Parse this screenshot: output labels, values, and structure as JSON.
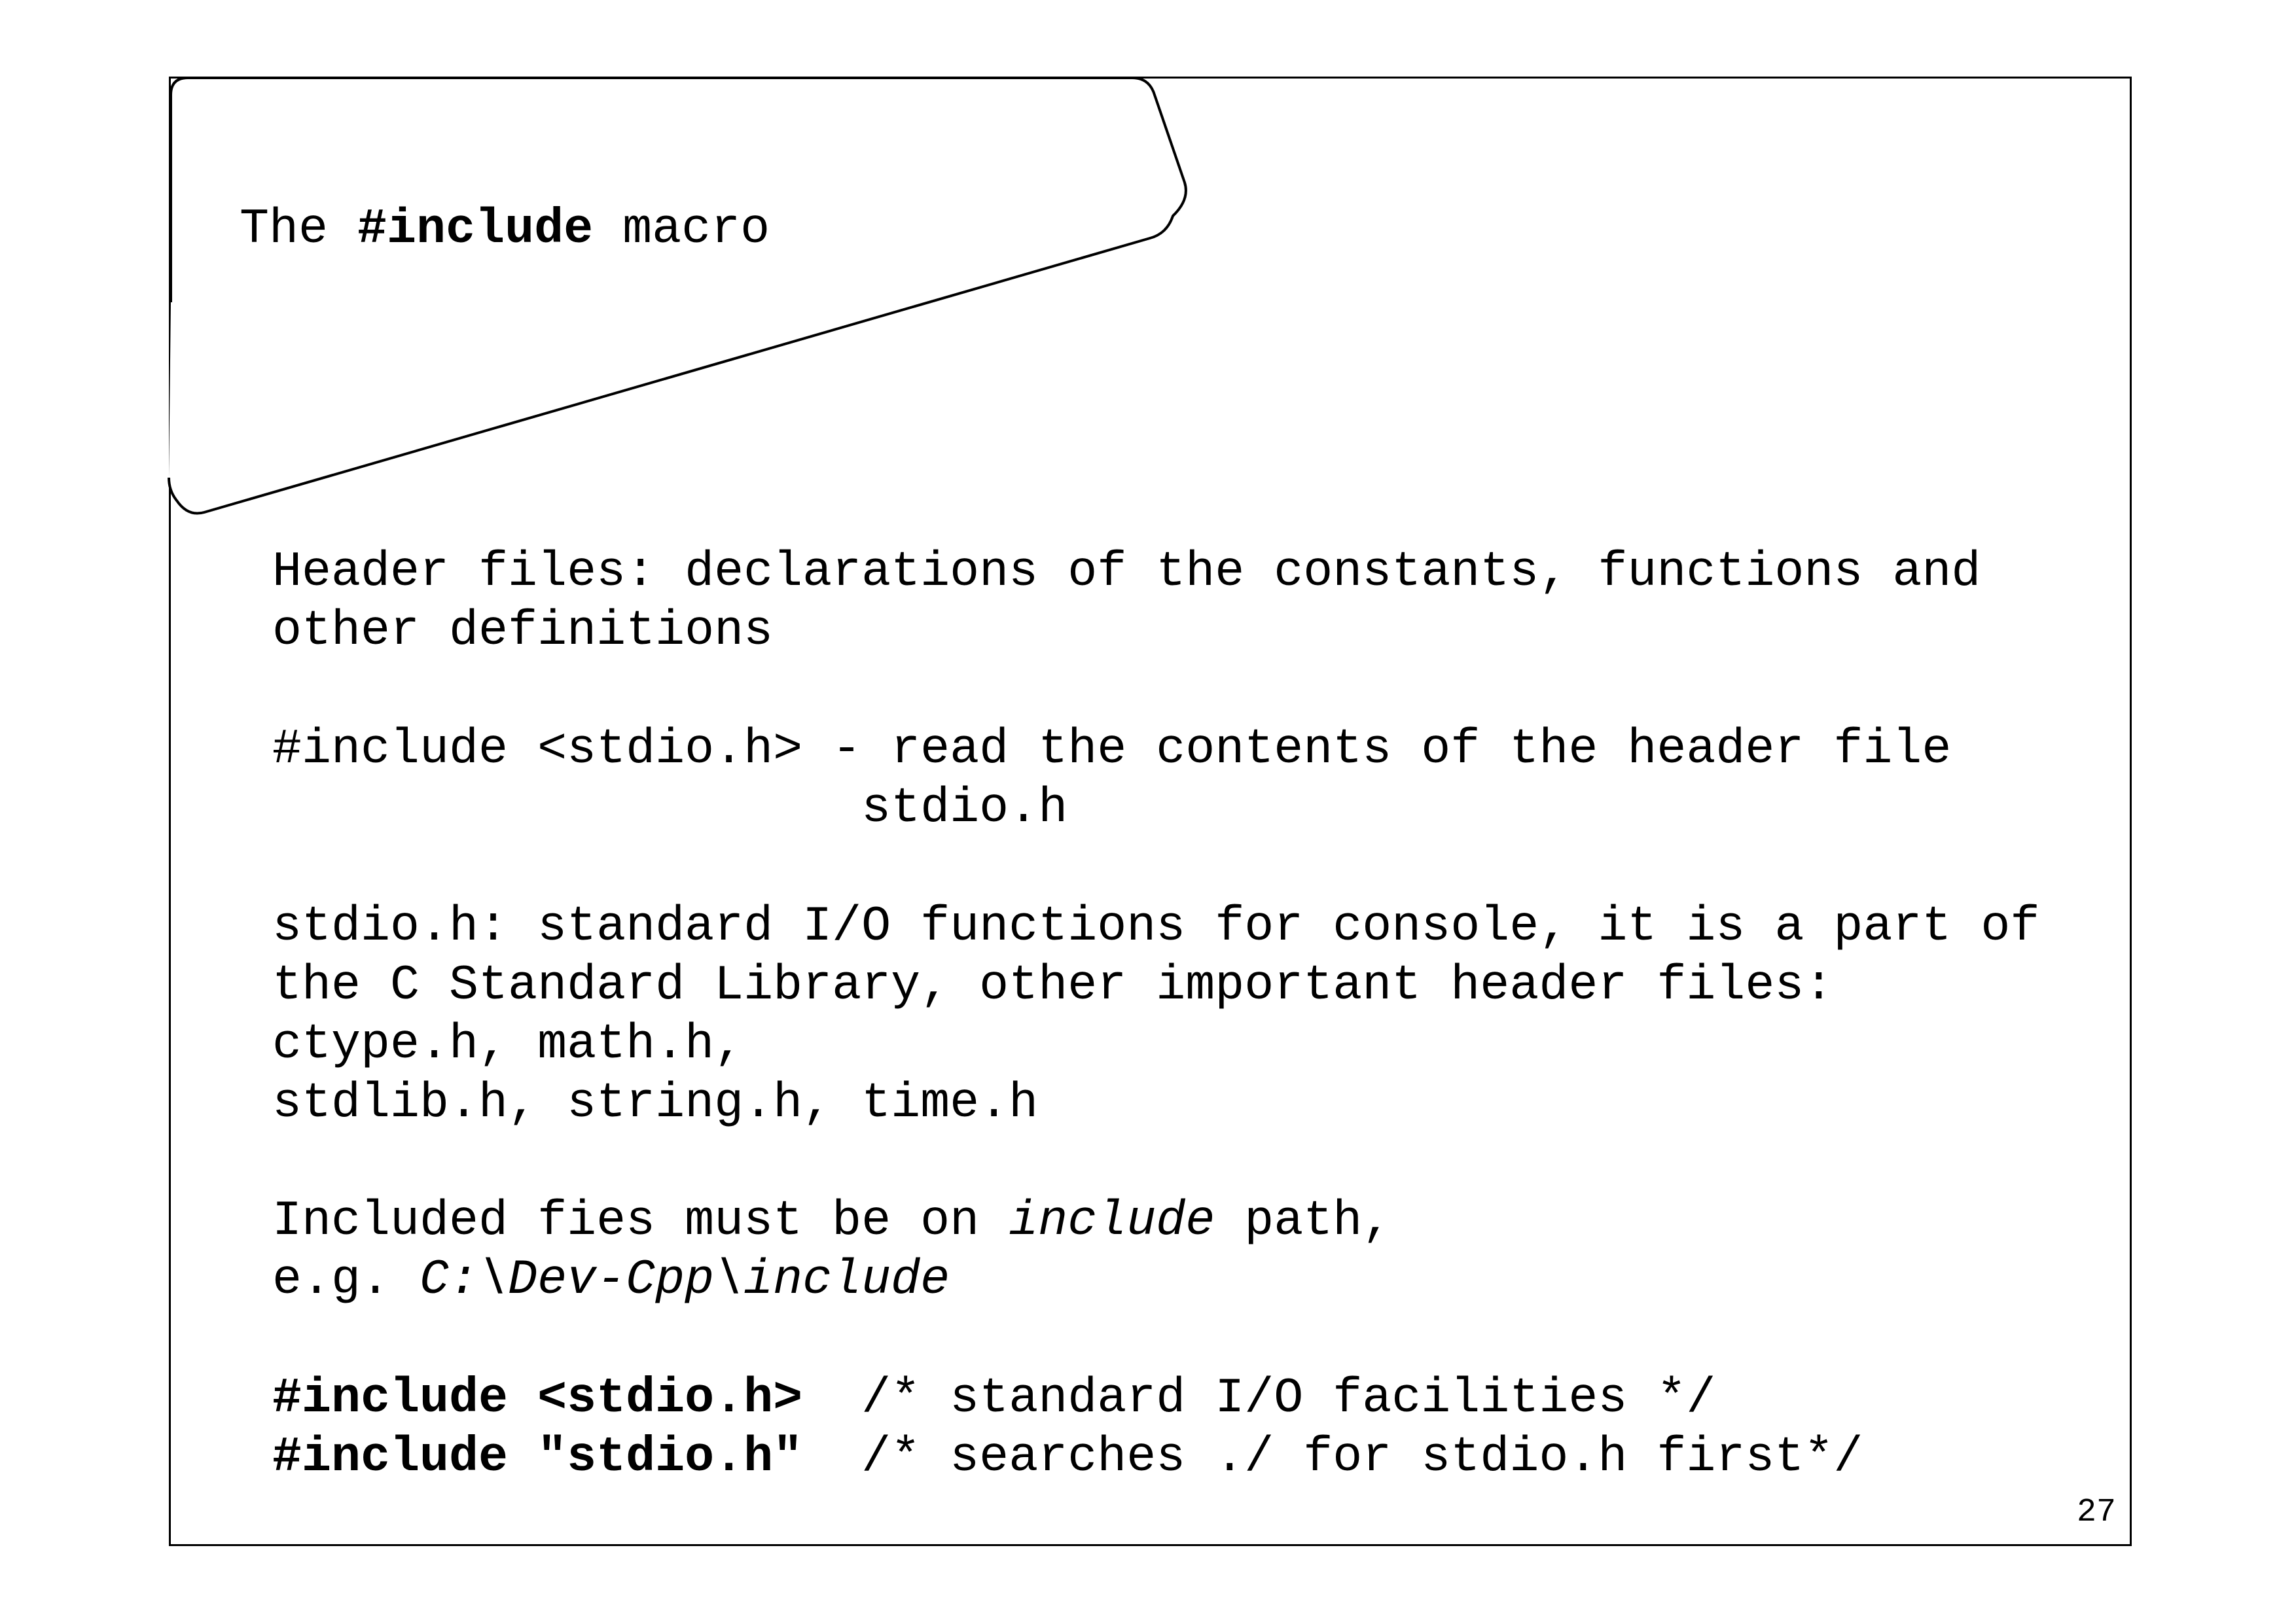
{
  "slide": {
    "title": {
      "prefix": "The ",
      "keyword": "#include",
      "suffix": " macro"
    },
    "para1": {
      "line1": "Header files: declarations of the constants, functions and",
      "line2": "other definitions"
    },
    "para2": {
      "line1": "#include <stdio.h> - read the contents of the header file",
      "line2": "                    stdio.h"
    },
    "para3": {
      "line1": "stdio.h: standard I/O functions for console, it is a part of",
      "line2": "the C Standard Library, other important header files:",
      "line3": "ctype.h, math.h,",
      "line4": "stdlib.h, string.h, time.h"
    },
    "para4": {
      "line1_a": "Included fies must be on ",
      "line1_italic": "include",
      "line1_b": " path,",
      "line2_a": "e.g. ",
      "line2_italic": "C:\\Dev-Cpp\\include"
    },
    "code": {
      "line1_code": "#include <stdio.h>",
      "line1_comment": "  /* standard I/O facilities */",
      "line2_code": "#include \"stdio.h\"",
      "line2_comment": "  /* searches ./ for stdio.h first*/"
    },
    "page_number": "27"
  }
}
